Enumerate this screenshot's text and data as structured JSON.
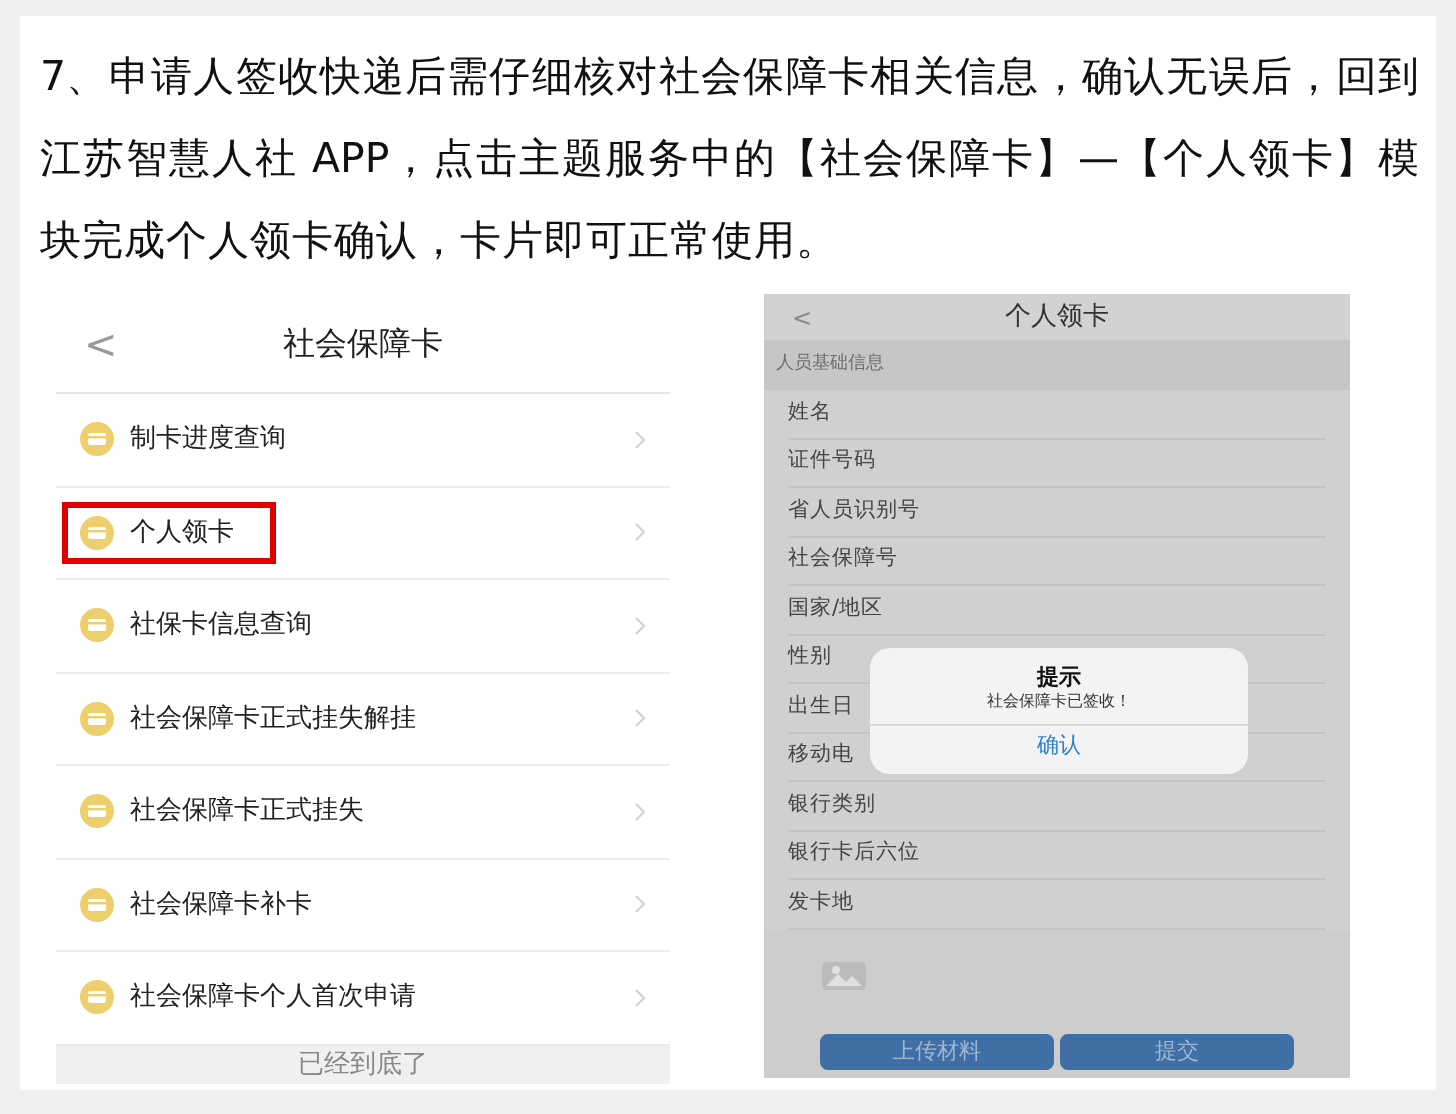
{
  "paragraph": "7、申请人签收快递后需仔细核对社会保障卡相关信息，确认无误后，回到江苏智慧人社 APP，点击主题服务中的【社会保障卡】—【个人领卡】模块完成个人领卡确认，卡片即可正常使用。",
  "left_screen": {
    "back": "<",
    "title": "社会保障卡",
    "items": [
      {
        "label": "制卡进度查询",
        "highlighted": false
      },
      {
        "label": "个人领卡",
        "highlighted": true
      },
      {
        "label": "社保卡信息查询",
        "highlighted": false
      },
      {
        "label": "社会保障卡正式挂失解挂",
        "highlighted": false
      },
      {
        "label": "社会保障卡正式挂失",
        "highlighted": false
      },
      {
        "label": "社会保障卡补卡",
        "highlighted": false
      },
      {
        "label": "社会保障卡个人首次申请",
        "highlighted": false
      }
    ],
    "footer": "已经到底了"
  },
  "right_screen": {
    "back": "<",
    "title": "个人领卡",
    "section": "人员基础信息",
    "fields": [
      "姓名",
      "证件号码",
      "省人员识别号",
      "社会保障号",
      "国家/地区",
      "性别",
      "出生日",
      "移动电",
      "银行类别",
      "银行卡后六位",
      "发卡地"
    ],
    "buttons": [
      "上传材料",
      "提交"
    ],
    "dialog": {
      "title": "提示",
      "message": "社会保障卡已签收！",
      "button": "确认"
    }
  }
}
